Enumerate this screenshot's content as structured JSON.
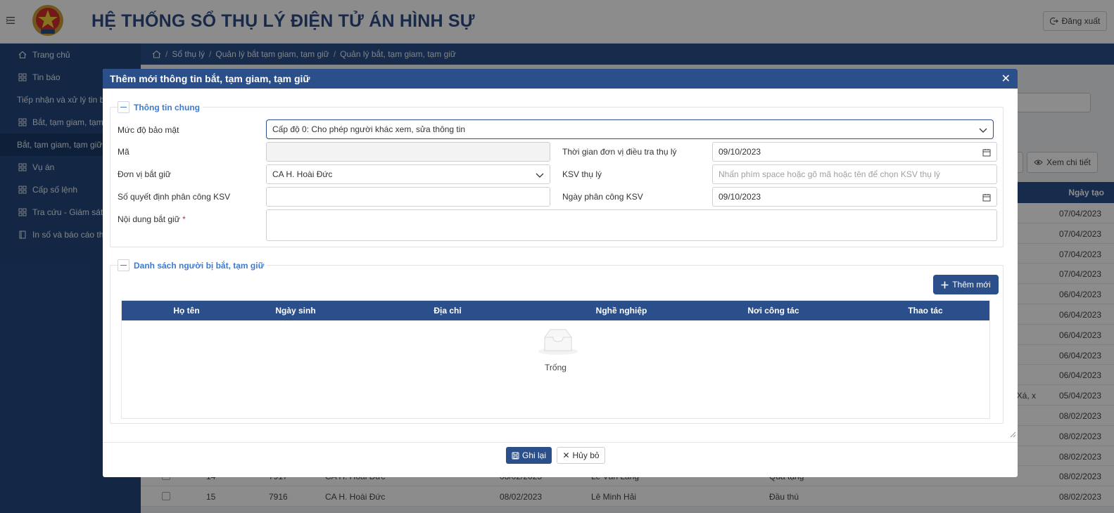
{
  "header": {
    "title": "HỆ THỐNG SỔ THỤ LÝ ĐIỆN TỬ ÁN HÌNH SỰ",
    "logout_label": "Đăng xuất"
  },
  "sidebar": {
    "items": [
      {
        "label": "Trang chủ",
        "icon": "home-icon"
      },
      {
        "label": "Tin báo",
        "icon": "grid-icon"
      },
      {
        "label": "Tiếp nhận và xử lý tin báo",
        "icon": ""
      },
      {
        "label": "Bắt, tạm giam, tạm giữ",
        "icon": "grid-icon"
      },
      {
        "label": "Bắt, tạm giam, tạm giữ",
        "icon": "",
        "active": true
      },
      {
        "label": "Vụ án",
        "icon": "grid-icon"
      },
      {
        "label": "Cấp số lệnh",
        "icon": "grid-icon"
      },
      {
        "label": "Tra cứu - Giám sát",
        "icon": "grid-icon"
      },
      {
        "label": "In số và báo cáo thống kê",
        "icon": "book-icon"
      }
    ]
  },
  "breadcrumb": [
    "Sổ thụ lý",
    "Quản lý bắt tạm giam, tạm giữ",
    "Quản lý bắt, tạm giam, tạm giữ"
  ],
  "background": {
    "buttons": {
      "partial_label": "a",
      "view_detail": "Xem chi tiết"
    },
    "table_header_date": "Ngày tạo",
    "rows": [
      {
        "date": "07/04/2023"
      },
      {
        "date": "07/04/2023"
      },
      {
        "date": "07/04/2023"
      },
      {
        "date": "07/04/2023"
      },
      {
        "date": "06/04/2023"
      },
      {
        "date": "06/04/2023"
      },
      {
        "date": "06/04/2023"
      },
      {
        "date": "06/04/2023"
      },
      {
        "date": "06/04/2023"
      },
      {
        "date": "05/04/2023",
        "addr": "ai Xá, x"
      },
      {
        "date": "08/02/2023"
      },
      {
        "date": "08/02/2023"
      },
      {
        "date": "08/02/2023"
      },
      {
        "stt": "14",
        "code": "7917",
        "unit": "CA H. Hoài Đức",
        "d1": "08/02/2023",
        "name": "Lê Văn Lăng",
        "addr": "Quà tặng",
        "date": "08/02/2023"
      },
      {
        "stt": "15",
        "code": "7916",
        "unit": "CA H. Hoài Đức",
        "d1": "08/02/2023",
        "name": "Lê Minh Hải",
        "addr": "Đầu thú",
        "date": "08/02/2023"
      }
    ]
  },
  "modal": {
    "title": "Thêm mới thông tin bắt, tạm giam, tạm giữ",
    "general": {
      "legend": "Thông tin chung",
      "security_label": "Mức độ bảo mật",
      "security_value": "Cấp độ 0: Cho phép người khác xem, sửa thông tin",
      "code_label": "Mã",
      "code_value": "",
      "investigation_time_label": "Thời gian đơn vị điều tra thụ lý",
      "investigation_time_value": "09/10/2023",
      "unit_label": "Đơn vị bắt giữ",
      "unit_value": "CA H. Hoài Đức",
      "ksv_label": "KSV thụ lý",
      "ksv_placeholder": "Nhấn phím space hoặc gõ mã hoặc tên để chọn KSV thụ lý",
      "decision_label": "Số quyết định phân công KSV",
      "decision_value": "",
      "assign_date_label": "Ngày phân công KSV",
      "assign_date_value": "09/10/2023",
      "content_label": "Nội dung bắt giữ",
      "required_mark": "*"
    },
    "persons": {
      "legend": "Danh sách người bị bắt, tạm giữ",
      "add_label": "Thêm mới",
      "columns": [
        "Họ tên",
        "Ngày sinh",
        "Địa chỉ",
        "Nghề nghiệp",
        "Nơi công tác",
        "Thao tác"
      ],
      "empty_text": "Trống"
    },
    "save_label": "Ghi lại",
    "cancel_label": "Hủy bỏ"
  },
  "colors": {
    "primary": "#2b4f8a",
    "sidebar": "#23477f",
    "legend": "#3e7bcf",
    "required": "#e0282e"
  }
}
